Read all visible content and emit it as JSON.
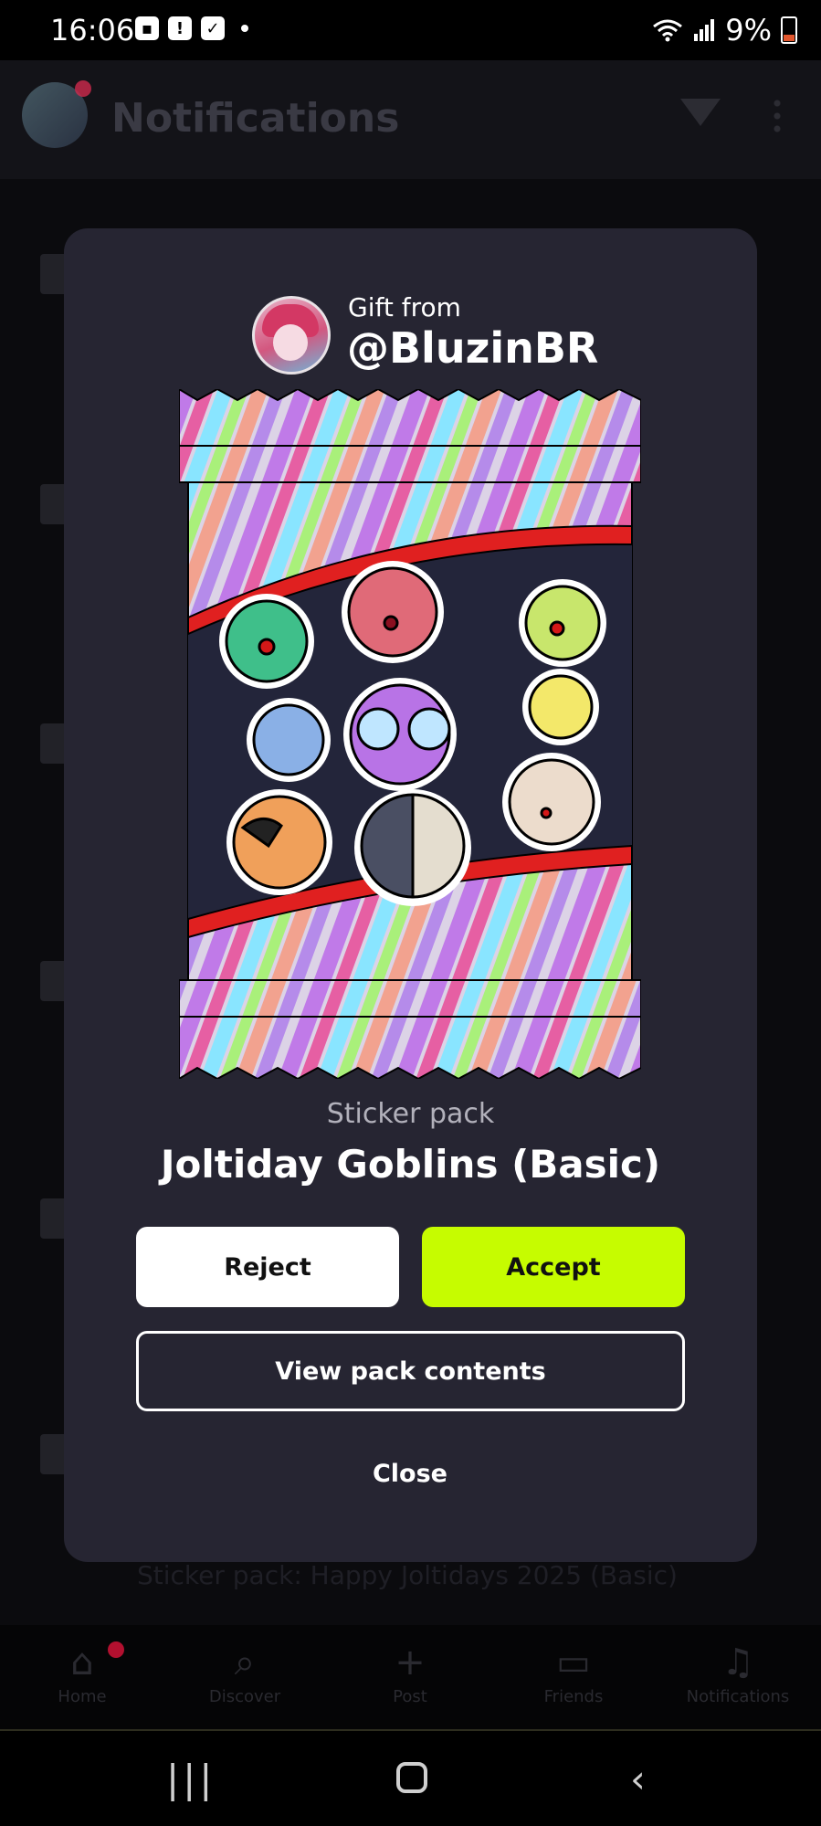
{
  "status_bar": {
    "time": "16:06",
    "battery_percent": "9%",
    "notification_icons": [
      "image-icon",
      "alert-icon",
      "check-icon"
    ]
  },
  "background_page": {
    "title": "Notifications",
    "footer_text": "Sticker pack: Happy Joltidays 2025 (Basic)"
  },
  "bottom_nav": {
    "items": [
      {
        "label": "Home",
        "icon": "home-icon"
      },
      {
        "label": "Discover",
        "icon": "search-icon"
      },
      {
        "label": "Post",
        "icon": "plus-icon"
      },
      {
        "label": "Friends",
        "icon": "chat-icon"
      },
      {
        "label": "Notifications",
        "icon": "bell-icon"
      }
    ]
  },
  "modal": {
    "gift_label": "Gift from",
    "sender": "@BluzinBR",
    "pack_type": "Sticker pack",
    "pack_name": "Joltiday Goblins (Basic)",
    "reject_label": "Reject",
    "accept_label": "Accept",
    "view_label": "View pack contents",
    "close_label": "Close"
  },
  "colors": {
    "accent": "#c6fc00",
    "modal_bg": "#262532",
    "page_bg": "#0f0f13"
  }
}
